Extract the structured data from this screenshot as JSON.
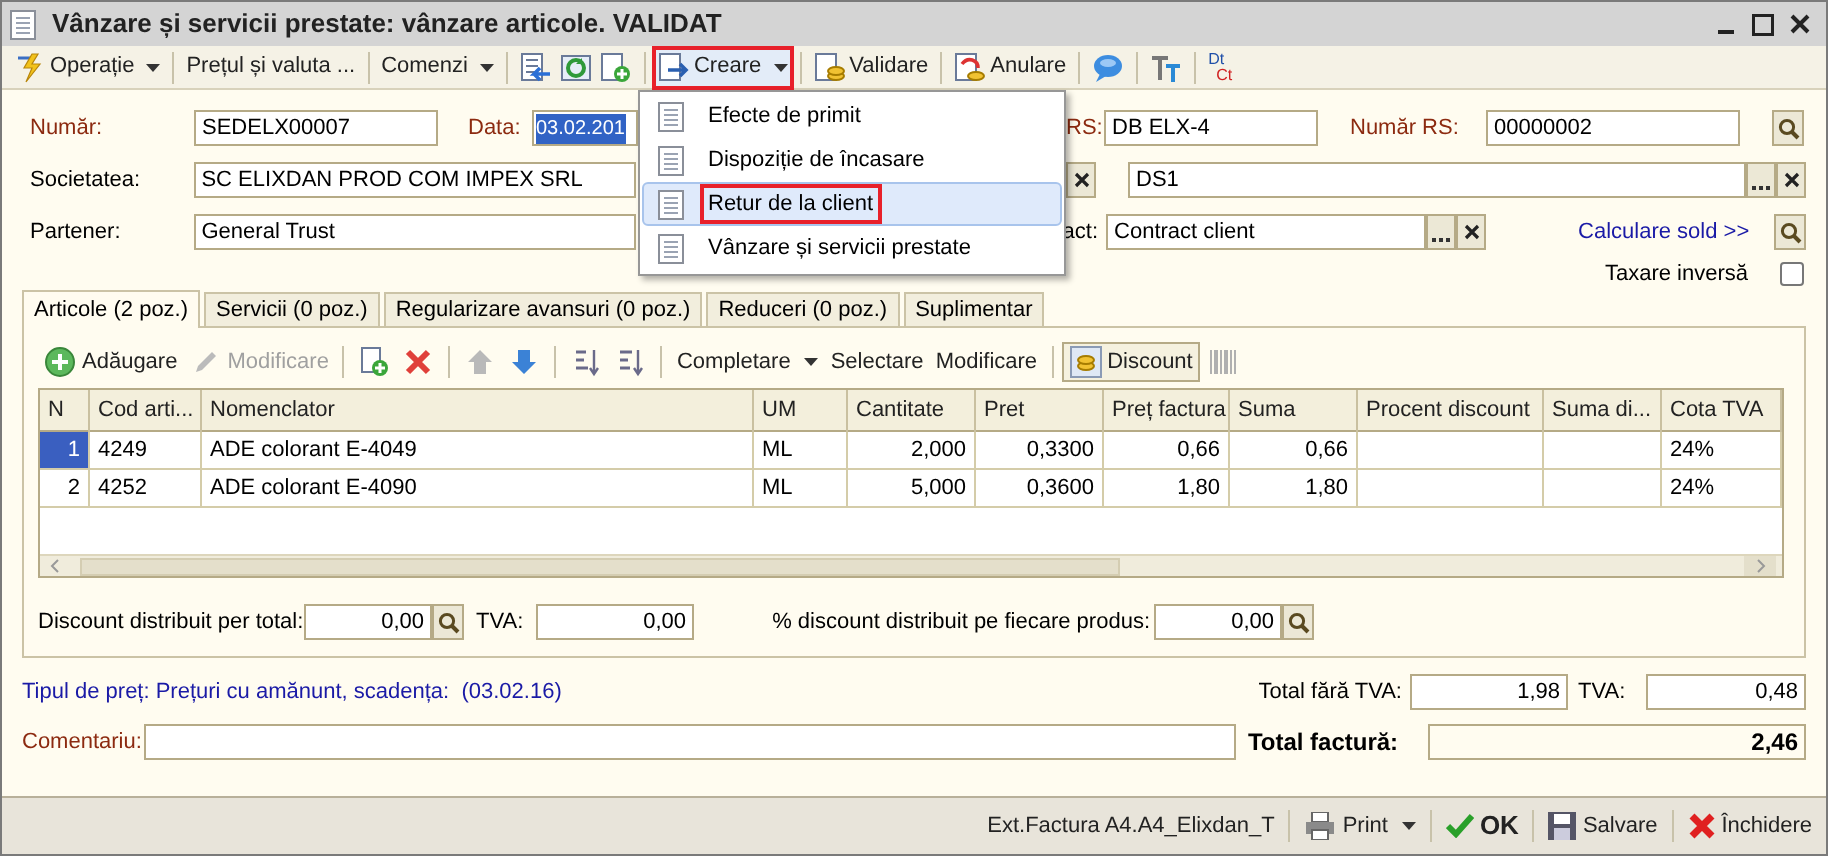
{
  "window": {
    "title": "Vânzare și servicii prestate: vânzare articole. VALIDAT"
  },
  "toolbar": [
    {
      "kind": "dropdown",
      "label": "Operație"
    },
    {
      "kind": "text",
      "label": "Prețul și valuta ..."
    },
    {
      "kind": "dropdown",
      "label": "Comenzi"
    },
    {
      "kind": "icon"
    },
    {
      "kind": "icon"
    },
    {
      "kind": "icon"
    },
    {
      "kind": "dropdown",
      "label": "Creare",
      "marked": true
    },
    {
      "kind": "text",
      "label": "Validare"
    },
    {
      "kind": "text",
      "label": "Anulare"
    },
    {
      "kind": "icon"
    },
    {
      "kind": "icon"
    },
    {
      "kind": "dtct",
      "label": "Dt",
      "sublabel": "Ct"
    }
  ],
  "menu": {
    "items": [
      {
        "label": "Efecte de primit",
        "selected": false,
        "marked": false
      },
      {
        "label": "Dispoziție de încasare",
        "selected": false,
        "marked": false
      },
      {
        "label": "Retur de la client",
        "selected": true,
        "marked": true
      },
      {
        "label": "Vânzare și servicii prestate",
        "selected": false,
        "marked": false
      }
    ]
  },
  "form": {
    "numar": {
      "label": "Număr:",
      "value": "SEDELX00007"
    },
    "data": {
      "label": "Data:",
      "value": "03.02.201"
    },
    "rs": {
      "label": "RS:",
      "value": "DB ELX-4"
    },
    "numar_rs": {
      "label": "Număr RS:",
      "value": "00000002"
    },
    "societatea": {
      "label": "Societatea:",
      "value": "SC ELIXDAN PROD COM IMPEX SRL"
    },
    "field_2": {
      "value": "DS1"
    },
    "partener": {
      "label": "Partener:",
      "value": "General Trust"
    },
    "contract": {
      "label": "act:",
      "value": "Contract client"
    },
    "calculare_link": "Calculare sold >>",
    "taxare_inversa": {
      "label": "Taxare inversă",
      "checked": false
    }
  },
  "tabs": [
    {
      "label": "Articole (2 poz.)",
      "selected": true
    },
    {
      "label": "Servicii (0 poz.)",
      "selected": false
    },
    {
      "label": "Regularizare avansuri (0 poz.)",
      "selected": false
    },
    {
      "label": "Reduceri (0 poz.)",
      "selected": false
    },
    {
      "label": "Suplimentar",
      "selected": false
    }
  ],
  "table_toolbar": [
    {
      "kind": "icon-text",
      "label": "Adăugare",
      "disabled": false
    },
    {
      "kind": "icon-text",
      "label": "Modificare",
      "disabled": true
    },
    {
      "kind": "icon"
    },
    {
      "kind": "icon"
    },
    {
      "kind": "icon",
      "disabled": true
    },
    {
      "kind": "icon",
      "disabled": false
    },
    {
      "kind": "icon"
    },
    {
      "kind": "icon"
    },
    {
      "kind": "dropdown",
      "label": "Completare",
      "disabled": false
    },
    {
      "kind": "text",
      "label": "Selectare",
      "disabled": false
    },
    {
      "kind": "text",
      "label": "Modificare",
      "disabled": false
    },
    {
      "kind": "button",
      "label": "Discount",
      "disabled": false
    },
    {
      "kind": "icon",
      "disabled": true
    }
  ],
  "table": {
    "columns": [
      "N",
      "Cod arti...",
      "Nomenclator",
      "UM",
      "Cantitate",
      "Pret",
      "Preț factura",
      "Suma",
      "Procent discount",
      "Suma di...",
      "Cota TVA"
    ],
    "rows": [
      {
        "selected": true,
        "cells": [
          "1",
          "4249",
          "ADE colorant E-4049",
          "ML",
          "2,000",
          "0,3300",
          "0,66",
          "0,66",
          "",
          "",
          "24%"
        ]
      },
      {
        "selected": false,
        "cells": [
          "2",
          "4252",
          "ADE colorant E-4090",
          "ML",
          "5,000",
          "0,3600",
          "1,80",
          "1,80",
          "",
          "",
          "24%"
        ]
      }
    ]
  },
  "discounts": {
    "per_total": {
      "label": "Discount distribuit per total:",
      "value": "0,00"
    },
    "tva": {
      "label": "TVA:",
      "value": "0,00"
    },
    "per_produs": {
      "label": "% discount distribuit pe fiecare produs:",
      "value": "0,00"
    }
  },
  "footer": {
    "price_type": "Tipul de preț: Prețuri cu amănunt, scadența:  (03.02.16)",
    "total_fara_tva": {
      "label": "Total fără TVA:",
      "value": "1,98"
    },
    "tva": {
      "label": "TVA:",
      "value": "0,48"
    },
    "comentariu": {
      "label": "Comentariu:"
    },
    "total_factura": {
      "label": "Total factură:",
      "value": "2,46"
    }
  },
  "status_bar": [
    {
      "kind": "text",
      "label": "Ext.Factura A4.A4_Elixdan_T"
    },
    {
      "kind": "dropdown",
      "label": "Print"
    },
    {
      "kind": "bold",
      "label": "OK"
    },
    {
      "kind": "text",
      "label": "Salvare"
    },
    {
      "kind": "text",
      "label": "Închidere"
    }
  ]
}
